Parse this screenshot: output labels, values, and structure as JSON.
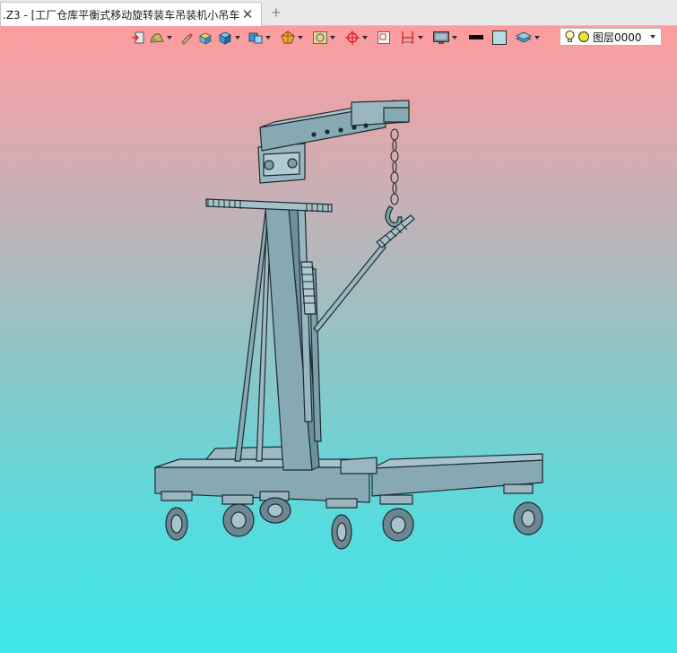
{
  "tab": {
    "title": ".Z3 - [工厂仓库平衡式移动旋转装车吊装机小吊车]",
    "close_glyph": "✕",
    "new_glyph": "+"
  },
  "toolbar": {
    "buttons": [
      {
        "name": "exit-view-icon",
        "dropdown": false
      },
      {
        "name": "render-mode-icon",
        "dropdown": true
      },
      {
        "name": "pencil-icon",
        "dropdown": false
      },
      {
        "name": "shaded-box-icon",
        "dropdown": false
      },
      {
        "name": "view-cube-icon",
        "dropdown": true
      },
      {
        "name": "view-orientation-icon",
        "dropdown": true
      },
      {
        "name": "section-plane-icon",
        "dropdown": true
      },
      {
        "name": "filter-icon",
        "dropdown": true
      },
      {
        "name": "snap-target-icon",
        "dropdown": true
      },
      {
        "name": "fit-window-icon",
        "dropdown": false
      },
      {
        "name": "dimension-icon",
        "dropdown": true
      },
      {
        "name": "display-monitor-icon",
        "dropdown": true
      },
      {
        "name": "line-color-swatch",
        "dropdown": false
      },
      {
        "name": "fill-color-swatch",
        "dropdown": false
      },
      {
        "name": "layer-stack-icon",
        "dropdown": true
      }
    ],
    "layer": {
      "label": "图层0000"
    }
  },
  "colors": {
    "line_swatch": "#0a0a0a",
    "fill_swatch": "#b5dde6",
    "model_fill": "#86a9b3",
    "model_stroke": "#1f2b31",
    "bg_top": "#fe9c9e",
    "bg_bottom": "#3ee6e8"
  }
}
